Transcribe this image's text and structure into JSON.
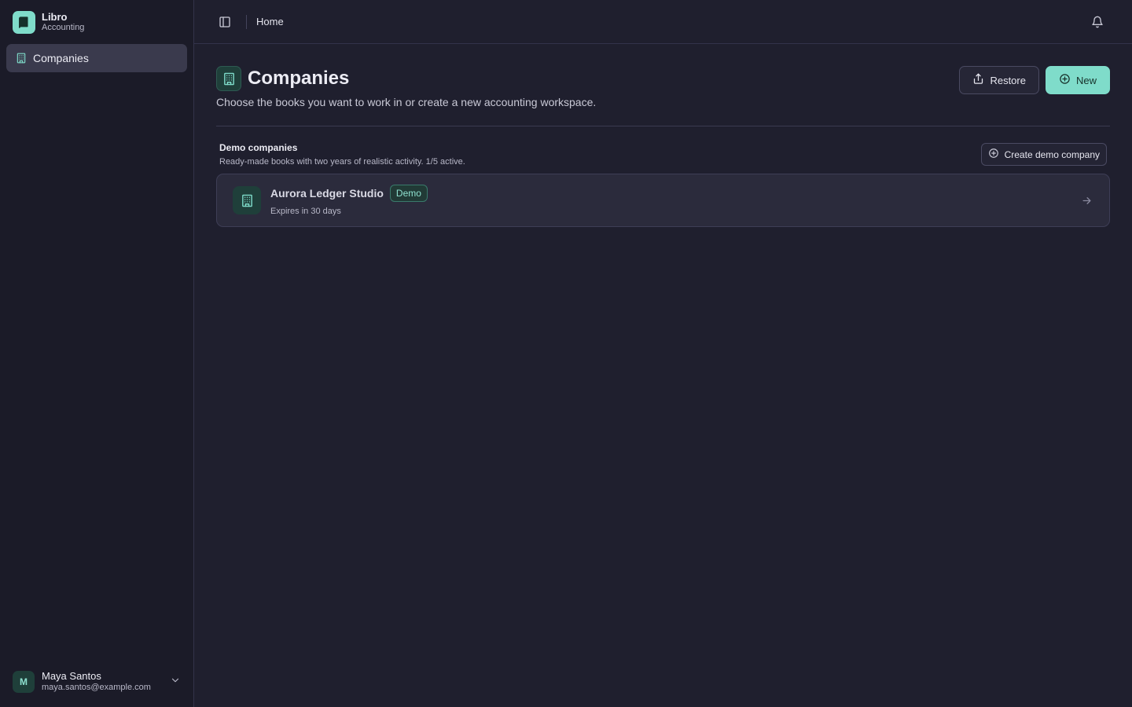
{
  "brand": {
    "name": "Libro",
    "subtitle": "Accounting",
    "color": "#7fdcca"
  },
  "sidebar": {
    "items": [
      {
        "label": "Companies",
        "icon": "building-icon",
        "active": true
      }
    ]
  },
  "user": {
    "initial": "M",
    "name": "Maya Santos",
    "email": "maya.santos@example.com"
  },
  "topbar": {
    "breadcrumb": "Home"
  },
  "page": {
    "title": "Companies",
    "description": "Choose the books you want to work in or create a new accounting workspace.",
    "restore_label": "Restore",
    "new_label": "New"
  },
  "demo_section": {
    "title": "Demo companies",
    "subtitle": "Ready-made books with two years of realistic activity. 1/5 active.",
    "create_label": "Create demo company"
  },
  "companies": [
    {
      "name": "Aurora Ledger Studio",
      "badge": "Demo",
      "expiry": "Expires in 30 days"
    }
  ]
}
